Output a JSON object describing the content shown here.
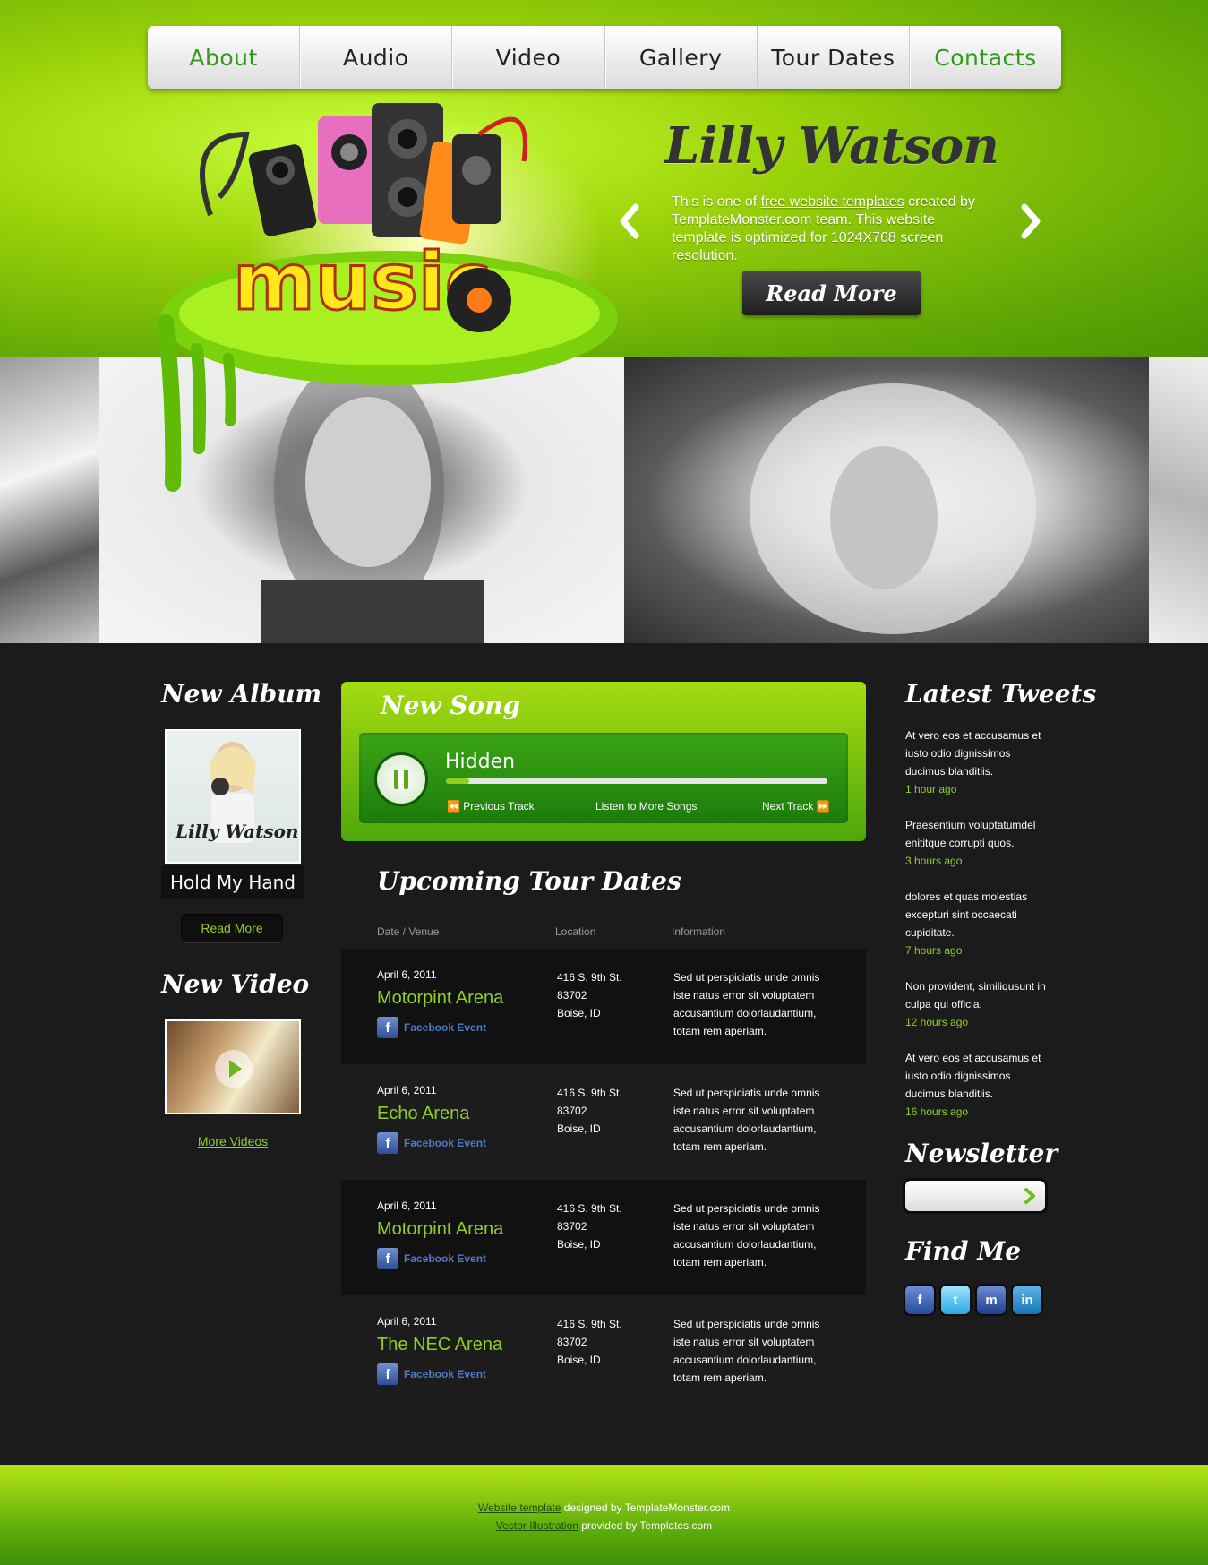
{
  "nav": {
    "items": [
      "About",
      "Audio",
      "Video",
      "Gallery",
      "Tour Dates",
      "Contacts"
    ],
    "active": [
      "About",
      "Contacts"
    ]
  },
  "hero": {
    "name": "Lilly Watson",
    "text_before": "This is one of ",
    "text_link": "free website templates",
    "text_after": " created by TemplateMonster.com team. This website template is optimized for 1024X768 screen resolution.",
    "button": "Read More"
  },
  "logo_text": "music",
  "album": {
    "title": "New Album",
    "cover_name": "Lilly Watson",
    "caption": "Hold My Hand",
    "button": "Read More"
  },
  "video": {
    "title": "New Video",
    "more_link": "More Videos"
  },
  "song": {
    "title": "New Song",
    "track": "Hidden",
    "progress": 0.06,
    "prev_label": "Previous Track",
    "more_label": "Listen to More Songs",
    "next_label": "Next Track"
  },
  "tour": {
    "title": "Upcoming Tour Dates",
    "headers": {
      "date": "Date / Venue",
      "location": "Location",
      "info": "Information"
    },
    "rows": [
      {
        "date": "April 6, 2011",
        "venue": "Motorpint Arena",
        "fb": "Facebook Event",
        "addr1": "416 S. 9th St.",
        "addr2": "83702",
        "addr3": "Boise, ID",
        "info": "Sed ut perspiciatis unde omnis iste natus error sit voluptatem accusantium dolorlaudantium, totam rem aperiam."
      },
      {
        "date": "April 6, 2011",
        "venue": "Echo Arena",
        "fb": "Facebook Event",
        "addr1": "416 S. 9th St.",
        "addr2": "83702",
        "addr3": "Boise, ID",
        "info": "Sed ut perspiciatis unde omnis iste natus error sit voluptatem accusantium dolorlaudantium, totam rem aperiam."
      },
      {
        "date": "April 6, 2011",
        "venue": "Motorpint Arena",
        "fb": "Facebook Event",
        "addr1": "416 S. 9th St.",
        "addr2": "83702",
        "addr3": "Boise, ID",
        "info": "Sed ut perspiciatis unde omnis iste natus error sit voluptatem accusantium dolorlaudantium, totam rem aperiam."
      },
      {
        "date": "April 6, 2011",
        "venue": "The NEC Arena",
        "fb": "Facebook Event",
        "addr1": "416 S. 9th St.",
        "addr2": "83702",
        "addr3": "Boise, ID",
        "info": "Sed ut perspiciatis unde omnis iste natus error sit voluptatem accusantium dolorlaudantium, totam rem aperiam."
      }
    ]
  },
  "tweets": {
    "title": "Latest Tweets",
    "items": [
      {
        "text": "At vero eos et accusamus et iusto odio dignissimos ducimus blanditiis.",
        "time": "1 hour ago"
      },
      {
        "text": "Praesentium voluptatumdel enititque corrupti quos.",
        "time": "3 hours ago"
      },
      {
        "text": "dolores et quas molestias excepturi sint occaecati cupiditate.",
        "time": "7 hours ago"
      },
      {
        "text": "Non provident, similiqusunt in culpa qui officia.",
        "time": "12 hours ago"
      },
      {
        "text": "At vero eos et accusamus et iusto odio dignissimos ducimus blanditiis.",
        "time": "16 hours ago"
      }
    ]
  },
  "newsletter": {
    "title": "Newsletter",
    "placeholder": ""
  },
  "find_me": {
    "title": "Find Me",
    "icons": [
      "facebook-icon",
      "twitter-icon",
      "myspace-icon",
      "linkedin-icon"
    ]
  },
  "footer": {
    "line1_link": "Website template",
    "line1_text": " designed by TemplateMonster.com",
    "line2_link": "Vector Illustration",
    "line2_text": " provided by Templates.com"
  },
  "colors": {
    "accent": "#8fd11e",
    "header_green": "#9dd40a",
    "background": "#1b1b1b",
    "facebook_link": "#4f7bc5"
  }
}
